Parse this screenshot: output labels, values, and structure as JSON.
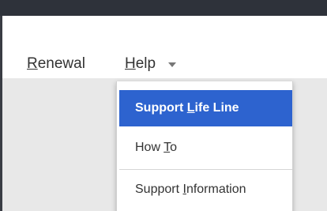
{
  "menubar": {
    "renewal_label": "Renewal",
    "help_label": "Help",
    "help_caret_icon": "chevron-down-icon"
  },
  "dropdown": {
    "items": [
      {
        "pre": "Support ",
        "accel": "L",
        "post": "ife Line",
        "selected": true
      },
      {
        "pre": "How ",
        "accel": "T",
        "post": "o",
        "selected": false
      },
      {
        "pre": "Support ",
        "accel": "I",
        "post": "nformation",
        "selected": false
      }
    ]
  },
  "colors": {
    "selection": "#2d63cf",
    "title_strip": "#2e323a"
  }
}
